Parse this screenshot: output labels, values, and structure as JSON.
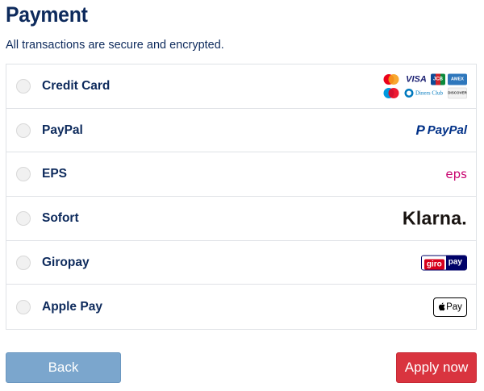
{
  "header": {
    "title": "Payment",
    "subtitle": "All transactions are secure and encrypted."
  },
  "payment_options": [
    {
      "label": "Credit Card",
      "logo": "card-brands-icon",
      "selected": false
    },
    {
      "label": "PayPal",
      "logo": "paypal-logo",
      "logo_text": "PayPal",
      "selected": false
    },
    {
      "label": "EPS",
      "logo": "eps-logo",
      "logo_text": "eps",
      "selected": false
    },
    {
      "label": "Sofort",
      "logo": "klarna-logo",
      "logo_text": "Klarna.",
      "selected": false
    },
    {
      "label": "Giropay",
      "logo": "giropay-logo",
      "logo_text_left": "giro",
      "logo_text_right": "pay",
      "selected": false
    },
    {
      "label": "Apple Pay",
      "logo": "apple-pay-logo",
      "logo_text": "Pay",
      "selected": false
    }
  ],
  "card_brands": {
    "visa": "VISA",
    "jcb": "JCB",
    "amex": "AMEX",
    "diners": "Diners Club",
    "discover": "DISCOVER"
  },
  "colors": {
    "brand_navy": "#0d2a5c",
    "back_button": "#7ba6cd",
    "apply_button": "#d9343f",
    "border": "#dfe2e6"
  },
  "actions": {
    "back_label": "Back",
    "apply_label": "Apply now"
  }
}
